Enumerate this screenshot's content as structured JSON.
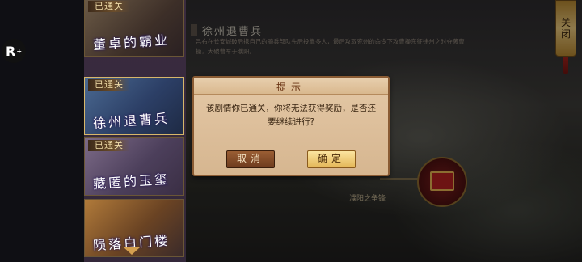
{
  "app_logo": "R",
  "stage_list": [
    {
      "badge": "已通关",
      "title": "董卓的霸业"
    },
    {
      "badge": "已通关",
      "title": "徐州退曹兵"
    },
    {
      "badge": "已通关",
      "title": "藏匿的玉玺"
    },
    {
      "badge": "",
      "title": "陨落白门楼"
    }
  ],
  "stage_info": {
    "title": "徐州退曹兵",
    "description": "吕布在长安城破后携自己的骑兵部队先后投靠多人，最后攻取兖州的命令下攻曹操东征徐州之时夺袭曹操，大破曹军于濮阳。"
  },
  "close_button": {
    "label_top": "关",
    "label_bottom": "闭"
  },
  "reward": {
    "caption": "濮阳之争锋"
  },
  "dialog": {
    "title": "提示",
    "message": "该剧情你已通关，你将无法获得奖励，是否还要继续进行?",
    "cancel_label": "取消",
    "confirm_label": "确定"
  },
  "colors": {
    "dialog_bg": "#e4c8a6",
    "cancel_button": "#8a5230",
    "confirm_button": "#f2d488"
  }
}
